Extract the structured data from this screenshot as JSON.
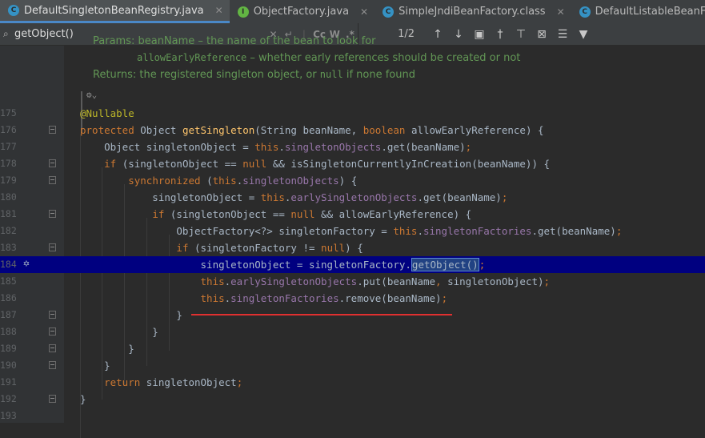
{
  "tabs": [
    {
      "label": "DefaultSingletonBeanRegistry.java",
      "icon": "class-icon",
      "active": true
    },
    {
      "label": "ObjectFactory.java",
      "icon": "interface-icon",
      "active": false
    },
    {
      "label": "SimpleJndiBeanFactory.class",
      "icon": "class-icon",
      "active": false
    },
    {
      "label": "DefaultListableBeanFactory.class",
      "icon": "class-icon",
      "active": false
    }
  ],
  "find": {
    "query": "getObject()",
    "match_count": "1/2",
    "option_case": "Cc",
    "option_words": "W",
    "option_regex": ".*"
  },
  "doc": {
    "params_line": "Params: beanName – the name of the bean to look for",
    "early_ref_param": "allowEarlyReference",
    "early_ref_desc": " – whether early references should be created or not",
    "returns_prefix": "Returns: the registered singleton object, or ",
    "returns_null": "null",
    "returns_suffix": " if none found"
  },
  "code_lines": [
    {
      "n": "175",
      "html": "<span class='ann'>@Nullable</span>"
    },
    {
      "n": "176",
      "html": "<span class='kw'>protected </span>Object <span class='mth'>getSingleton</span>(String beanName, <span class='kw'>boolean </span>allowEarlyReference) {"
    },
    {
      "n": "177",
      "html": "    Object singletonObject = <span class='kw'>this</span>.<span class='fld'>singletonObjects</span>.get(beanName)<span class='kw'>;</span>"
    },
    {
      "n": "178",
      "html": "    <span class='kw'>if </span>(singletonObject == <span class='kw'>null </span>&amp;&amp; isSingletonCurrentlyInCreation(beanName)) {"
    },
    {
      "n": "179",
      "html": "        <span class='kw'>synchronized </span>(<span class='kw'>this</span>.<span class='fld'>singletonObjects</span>) {"
    },
    {
      "n": "180",
      "html": "            singletonObject = <span class='kw'>this</span>.<span class='fld'>earlySingletonObjects</span>.get(beanName)<span class='kw'>;</span>"
    },
    {
      "n": "181",
      "html": "            <span class='kw'>if </span>(singletonObject == <span class='kw'>null </span>&amp;&amp; allowEarlyReference) {"
    },
    {
      "n": "182",
      "html": "                ObjectFactory&lt;?&gt; singletonFactory = <span class='kw'>this</span>.<span class='fld'>singletonFactories</span>.get(beanName)<span class='kw'>;</span>"
    },
    {
      "n": "183",
      "html": "                <span class='kw'>if </span>(singletonFactory != <span class='kw'>null</span>) {"
    },
    {
      "n": "184",
      "html": "                    singletonObject = singletonFactory.<span class='sel'>getObject()</span><span class='kw'>;</span>"
    },
    {
      "n": "185",
      "html": "                    <span class='kw'>this</span>.<span class='fld'>earlySingletonObjects</span>.put(beanName<span class='kw'>, </span>singletonObject)<span class='kw'>;</span>"
    },
    {
      "n": "186",
      "html": "                    <span class='kw'>this</span>.<span class='fld'>singletonFactories</span>.remove(beanName)<span class='kw'>;</span>"
    },
    {
      "n": "187",
      "html": "                }"
    },
    {
      "n": "188",
      "html": "            }"
    },
    {
      "n": "189",
      "html": "        }"
    },
    {
      "n": "190",
      "html": "    }"
    },
    {
      "n": "191",
      "html": "    <span class='kw'>return </span>singletonObject<span class='kw'>;</span>"
    },
    {
      "n": "192",
      "html": "}"
    },
    {
      "n": "193",
      "html": ""
    }
  ],
  "colors": {
    "keyword": "#cc7832",
    "field": "#9876aa",
    "method": "#ffc66d",
    "annotation": "#bbb529",
    "doc_comment": "#629755",
    "execution_line": "#000080"
  }
}
